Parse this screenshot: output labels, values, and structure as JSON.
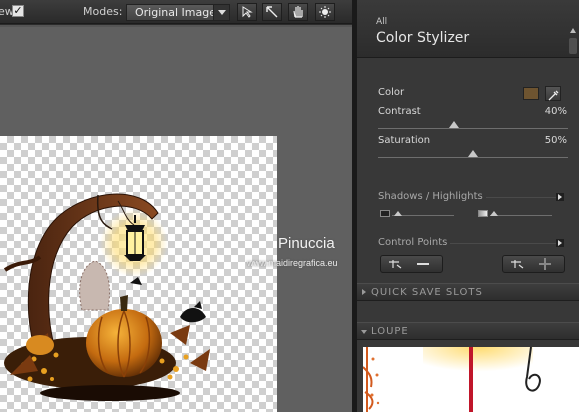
{
  "toolbar": {
    "preview_label": "ew:",
    "preview_checked": "✓",
    "modes_label": "Modes:",
    "modes_value": "Original Image",
    "tools": [
      "select-arrow-icon",
      "pointer-icon",
      "hand-icon",
      "light-icon"
    ]
  },
  "canvas": {
    "watermark_name": "Pinuccia",
    "watermark_url": "www.maidiregrafica.eu"
  },
  "panel": {
    "category": "All",
    "title": "Color Stylizer",
    "color_label": "Color",
    "color_swatch": "#6e5430",
    "contrast_label": "Contrast",
    "contrast_value": "40%",
    "contrast_level": 0.4,
    "saturation_label": "Saturation",
    "saturation_value": "50%",
    "saturation_level": 0.5,
    "shadows_label": "Shadows / Highlights",
    "control_points_label": "Control Points",
    "quick_save_label": "QUICK SAVE SLOTS",
    "loupe_label": "LOUPE"
  }
}
